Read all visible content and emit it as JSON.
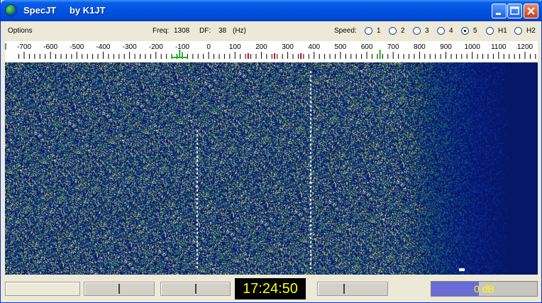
{
  "window": {
    "title": "SpecJT",
    "author": "by K1JT",
    "accent": "#0053e0"
  },
  "toolbar": {
    "menu_options": "Options",
    "freq_label": "Freq:",
    "freq_value": "1308",
    "df_label": "DF:",
    "df_value": "38",
    "df_unit": "(Hz)",
    "speed_label": "Speed:",
    "speeds": [
      {
        "label": "1",
        "checked": false
      },
      {
        "label": "2",
        "checked": false
      },
      {
        "label": "3",
        "checked": false
      },
      {
        "label": "4",
        "checked": false
      },
      {
        "label": "5",
        "checked": true
      },
      {
        "label": "H1",
        "checked": false
      },
      {
        "label": "H2",
        "checked": false
      }
    ]
  },
  "scale": {
    "tick_labels": [
      "-700",
      "-600",
      "-500",
      "-400",
      "-300",
      "-200",
      "-100",
      "0",
      "100",
      "200",
      "300",
      "400",
      "500",
      "600",
      "700",
      "800",
      "900",
      "1000",
      "1100",
      "1200"
    ],
    "min_hz": -700,
    "max_hz": 1200,
    "green_marker_hz": 650,
    "red_marker_hz": [
      150,
      250,
      350
    ],
    "green_range_hz": [
      -140,
      -80
    ]
  },
  "status": {
    "clock": "17:24:50",
    "level_text": "0 dB",
    "level_fraction": 0.45,
    "level_color": "#6b6bd6"
  }
}
